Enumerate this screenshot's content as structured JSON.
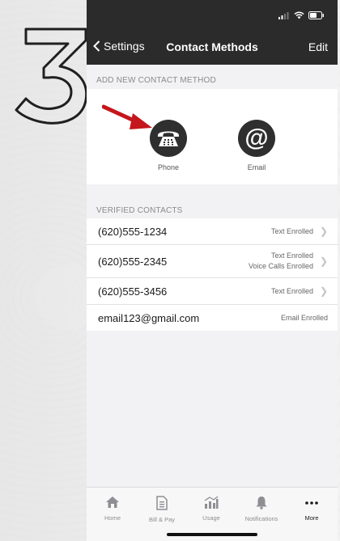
{
  "step": {
    "number": "3"
  },
  "nav": {
    "back_label": "Settings",
    "title": "Contact Methods",
    "edit_label": "Edit"
  },
  "add_section": {
    "header": "ADD NEW CONTACT METHOD",
    "methods": [
      {
        "label": "Phone",
        "icon": "telephone-icon"
      },
      {
        "label": "Email",
        "icon": "at-sign-icon"
      }
    ]
  },
  "verified": {
    "header": "VERIFIED CONTACTS",
    "contacts": [
      {
        "value": "(620)555-1234",
        "status_1": "Text Enrolled",
        "status_2": "",
        "chevron": true
      },
      {
        "value": "(620)555-2345",
        "status_1": "Text Enrolled",
        "status_2": "Voice Calls Enrolled",
        "chevron": true
      },
      {
        "value": "(620)555-3456",
        "status_1": "Text Enrolled",
        "status_2": "",
        "chevron": true
      },
      {
        "value": "email123@gmail.com",
        "status_1": "Email Enrolled",
        "status_2": "",
        "chevron": false
      }
    ]
  },
  "tabs": [
    {
      "label": "Home",
      "icon": "home-icon",
      "active": false
    },
    {
      "label": "Bill & Pay",
      "icon": "bill-icon",
      "active": false
    },
    {
      "label": "Usage",
      "icon": "usage-icon",
      "active": false
    },
    {
      "label": "Notifications",
      "icon": "bell-icon",
      "active": false
    },
    {
      "label": "More",
      "icon": "more-icon",
      "active": true
    }
  ],
  "colors": {
    "nav_bg": "#2b2b2b",
    "accent_arrow": "#c4161c",
    "icon_bg": "#2f2f2f"
  }
}
